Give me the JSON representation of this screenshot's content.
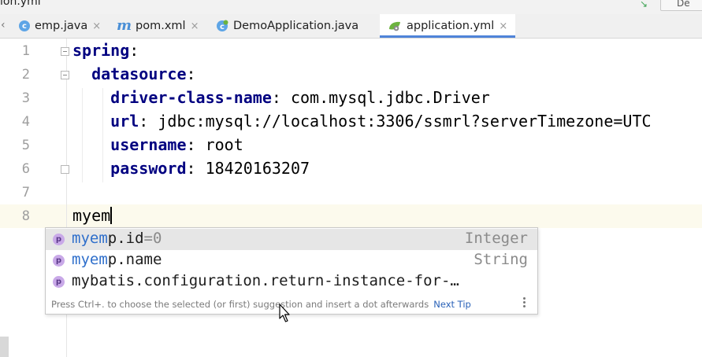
{
  "window": {
    "title_fragment": "ion.yml",
    "right_button_fragment": "De"
  },
  "tabs": [
    {
      "label": "emp.java",
      "icon": "java-class-icon",
      "active": false
    },
    {
      "label": "pom.xml",
      "icon": "maven-icon",
      "active": false
    },
    {
      "label": "DemoApplication.java",
      "icon": "spring-boot-class-icon",
      "active": false
    },
    {
      "label": "application.yml",
      "icon": "spring-config-icon",
      "active": true
    }
  ],
  "tab_close_glyph": "×",
  "editor": {
    "line_numbers": [
      "1",
      "2",
      "3",
      "4",
      "5",
      "6",
      "7",
      "8"
    ],
    "lines": [
      {
        "indent": "",
        "key": "spring",
        "sep": ":",
        "value": ""
      },
      {
        "indent": "  ",
        "key": "datasource",
        "sep": ":",
        "value": ""
      },
      {
        "indent": "    ",
        "key": "driver-class-name",
        "sep": ": ",
        "value": "com.mysql.jdbc.Driver"
      },
      {
        "indent": "    ",
        "key": "url",
        "sep": ": ",
        "value": "jdbc:mysql://localhost:3306/ssmrl?serverTimezone=UTC"
      },
      {
        "indent": "    ",
        "key": "username",
        "sep": ": ",
        "value": "root"
      },
      {
        "indent": "    ",
        "key": "password",
        "sep": ": ",
        "value": "18420163207"
      },
      {
        "indent": "",
        "key": "",
        "sep": "",
        "value": ""
      },
      {
        "indent": "",
        "key": "",
        "sep": "",
        "value": "myem"
      }
    ],
    "current_line": "8",
    "typed_text": "myem"
  },
  "completion": {
    "items": [
      {
        "icon_letter": "p",
        "match": "myem",
        "rest": "p.id",
        "suffix": "=0",
        "type": "Integer",
        "selected": true
      },
      {
        "icon_letter": "p",
        "match": "myem",
        "rest": "p.name",
        "suffix": "",
        "type": "String",
        "selected": false
      },
      {
        "icon_letter": "p",
        "match": "",
        "rest": "mybatis.configuration.return-instance-for-…",
        "suffix": "",
        "type": "",
        "selected": false
      }
    ],
    "hint": "Press Ctrl+. to choose the selected (or first) suggestion and insert a dot afterwards",
    "next_tip": "Next Tip"
  },
  "colors": {
    "key": "#000080",
    "match": "#2f6fcb",
    "accent_tab": "#4f84d9",
    "current_line": "#fcfaed"
  }
}
